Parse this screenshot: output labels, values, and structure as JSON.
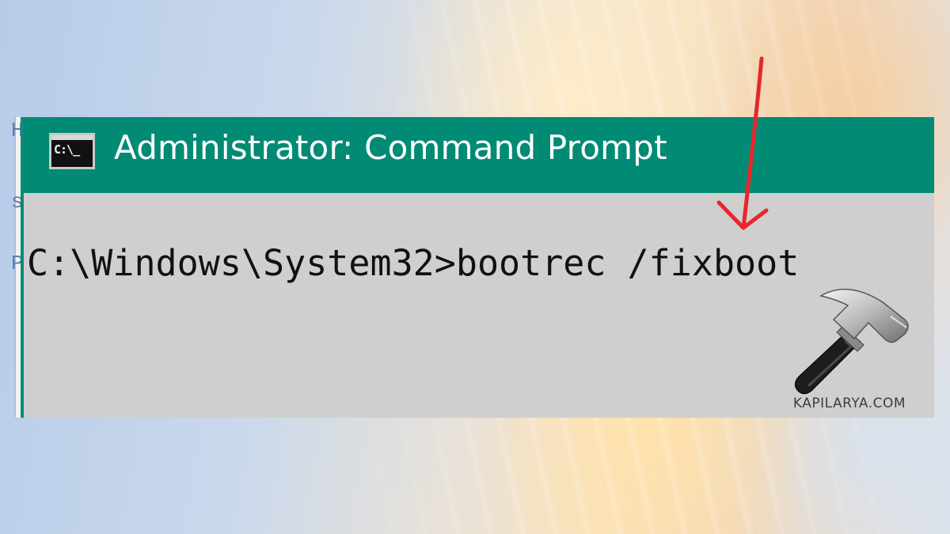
{
  "window": {
    "title": "Administrator: Command Prompt",
    "icon_text": "C:\\_",
    "icon": "cmd-console-icon"
  },
  "console": {
    "command_line": "C:\\Windows\\System32>bootrec /fixboot"
  },
  "background_window": {
    "fragments": [
      "H",
      "s",
      "P"
    ]
  },
  "annotation": {
    "type": "red-arrow",
    "color": "#e8262c"
  },
  "watermark": {
    "logo": "hammer-icon",
    "text": "KAPILARYA.COM"
  },
  "colors": {
    "title_bar": "#018b74",
    "console_background": "#cfcfcf",
    "console_text": "#111111"
  }
}
